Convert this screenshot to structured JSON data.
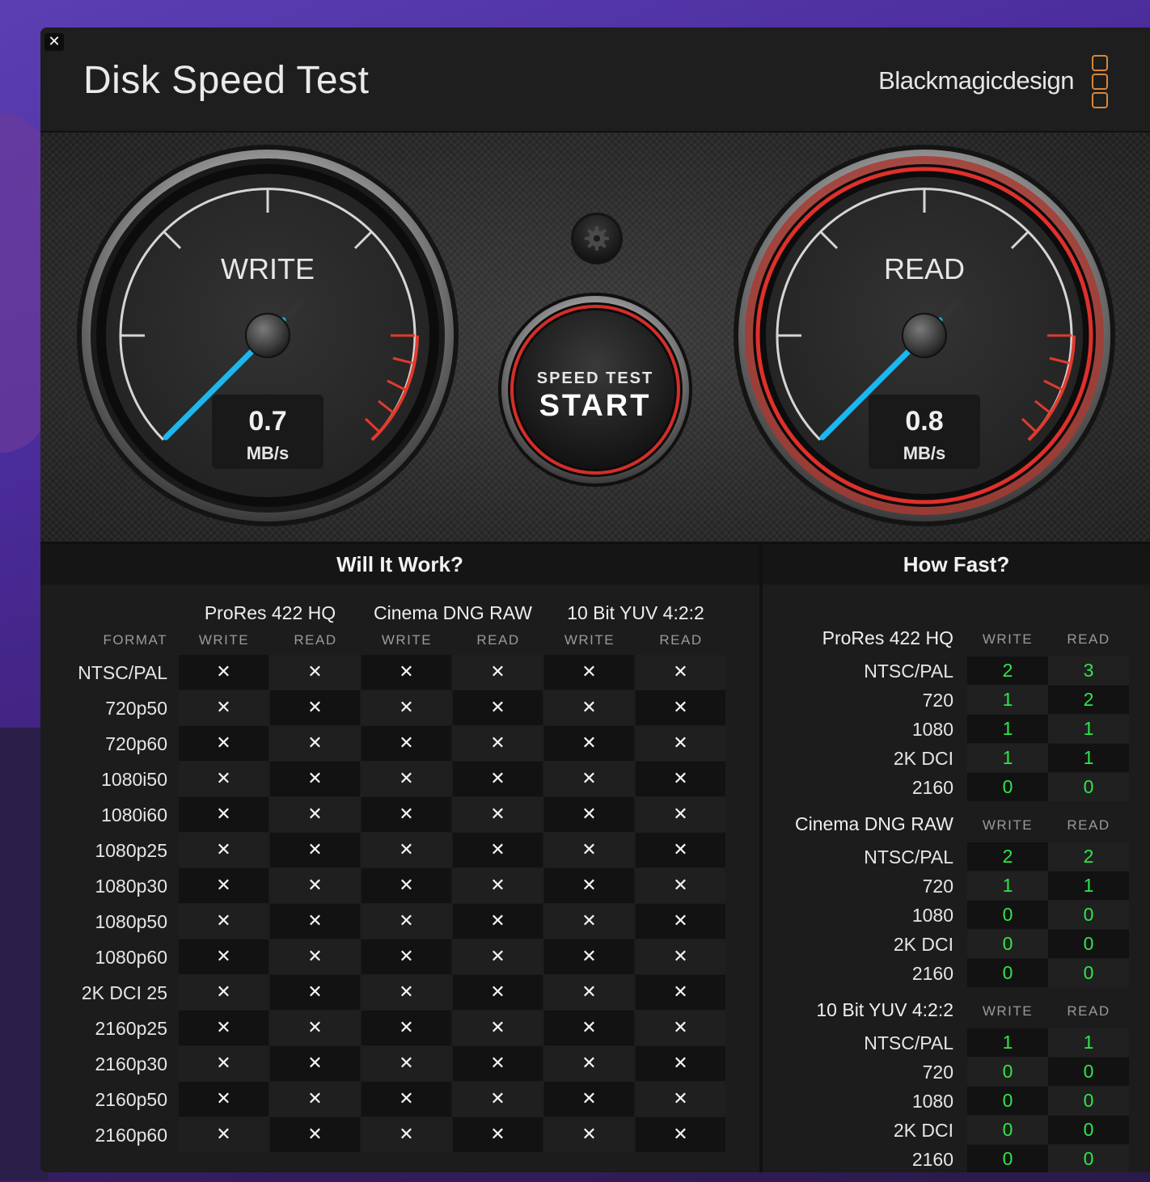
{
  "app": {
    "title": "Disk Speed Test",
    "brand": "Blackmagicdesign",
    "close_glyph": "✕",
    "icons": {
      "close": "close-icon",
      "settings": "gear-icon",
      "brand_logo": "blackmagic-logo-icon"
    }
  },
  "gauges": {
    "write": {
      "label": "WRITE",
      "value": "0.7",
      "unit": "MB/s",
      "ring_color": "#9a9a9a",
      "needle_color": "#1ab8f0"
    },
    "read": {
      "label": "READ",
      "value": "0.8",
      "unit": "MB/s",
      "ring_color": "#e0302a",
      "needle_color": "#1ab8f0"
    }
  },
  "start_button": {
    "line1": "SPEED TEST",
    "line2": "START",
    "ring_color": "#e0302a"
  },
  "will_it_work": {
    "title": "Will It Work?",
    "format_header": "FORMAT",
    "codecs": [
      "ProRes 422 HQ",
      "Cinema DNG RAW",
      "10 Bit YUV 4:2:2"
    ],
    "sub_headers": [
      "WRITE",
      "READ"
    ],
    "formats": [
      "NTSC/PAL",
      "720p50",
      "720p60",
      "1080i50",
      "1080i60",
      "1080p25",
      "1080p30",
      "1080p50",
      "1080p60",
      "2K DCI 25",
      "2160p25",
      "2160p30",
      "2160p50",
      "2160p60"
    ],
    "result_glyph": "✕"
  },
  "how_fast": {
    "title": "How Fast?",
    "sub_headers": [
      "WRITE",
      "READ"
    ],
    "value_color": "#2ee64a",
    "groups": [
      {
        "name": "ProRes 422 HQ",
        "rows": [
          {
            "label": "NTSC/PAL",
            "write": "2",
            "read": "3"
          },
          {
            "label": "720",
            "write": "1",
            "read": "2"
          },
          {
            "label": "1080",
            "write": "1",
            "read": "1"
          },
          {
            "label": "2K DCI",
            "write": "1",
            "read": "1"
          },
          {
            "label": "2160",
            "write": "0",
            "read": "0"
          }
        ]
      },
      {
        "name": "Cinema DNG RAW",
        "rows": [
          {
            "label": "NTSC/PAL",
            "write": "2",
            "read": "2"
          },
          {
            "label": "720",
            "write": "1",
            "read": "1"
          },
          {
            "label": "1080",
            "write": "0",
            "read": "0"
          },
          {
            "label": "2K DCI",
            "write": "0",
            "read": "0"
          },
          {
            "label": "2160",
            "write": "0",
            "read": "0"
          }
        ]
      },
      {
        "name": "10 Bit YUV 4:2:2",
        "rows": [
          {
            "label": "NTSC/PAL",
            "write": "1",
            "read": "1"
          },
          {
            "label": "720",
            "write": "0",
            "read": "0"
          },
          {
            "label": "1080",
            "write": "0",
            "read": "0"
          },
          {
            "label": "2K DCI",
            "write": "0",
            "read": "0"
          },
          {
            "label": "2160",
            "write": "0",
            "read": "0"
          }
        ]
      }
    ]
  }
}
